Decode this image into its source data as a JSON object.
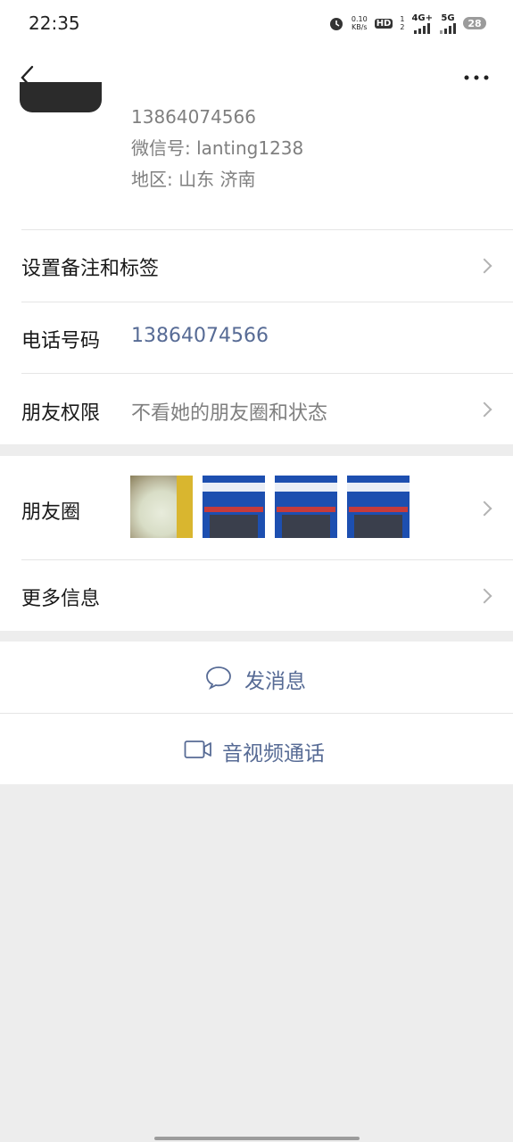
{
  "status": {
    "time": "22:35",
    "speed_value": "0.10",
    "speed_unit": "KB/s",
    "hd": "HD",
    "hd_sub": "1",
    "hd_sub2": "2",
    "net_4g": "4G+",
    "net_5g": "5G",
    "battery": "28"
  },
  "profile": {
    "phone": "13864074566",
    "wechat_id": "微信号: lanting1238",
    "region": "地区: 山东 济南"
  },
  "rows": {
    "remark": {
      "label": "设置备注和标签"
    },
    "phone": {
      "label": "电话号码",
      "value": "13864074566"
    },
    "permission": {
      "label": "朋友权限",
      "value": "不看她的朋友圈和状态"
    },
    "moments": {
      "label": "朋友圈"
    },
    "more": {
      "label": "更多信息"
    }
  },
  "actions": {
    "message": "发消息",
    "call": "音视频通话"
  },
  "colors": {
    "link": "#576b95",
    "bg": "#ededed",
    "chevron": "#b2b2b2"
  },
  "icons": [
    "back-arrow-icon",
    "more-dots-icon",
    "chevron-right-icon",
    "chat-bubble-icon",
    "video-camera-icon",
    "alarm-icon"
  ]
}
